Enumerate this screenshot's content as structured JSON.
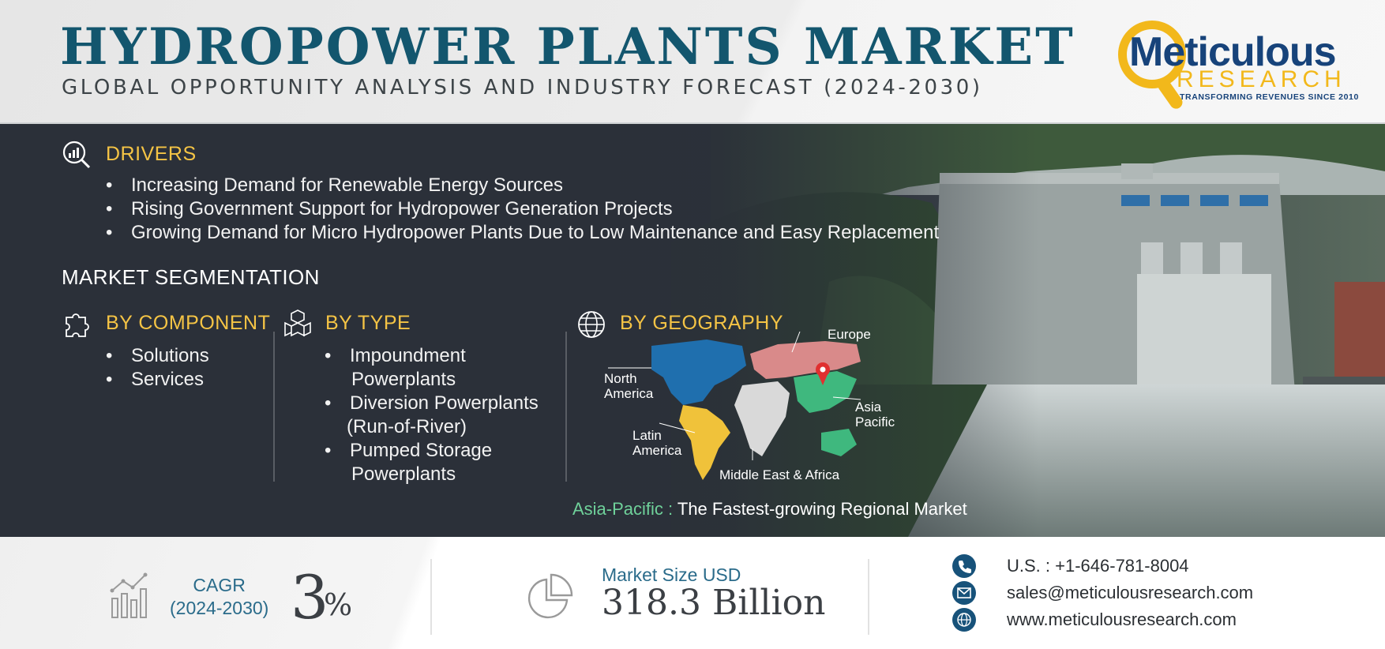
{
  "header": {
    "title": "HYDROPOWER PLANTS MARKET",
    "subtitle": "GLOBAL OPPORTUNITY ANALYSIS AND INDUSTRY FORECAST (2024-2030)"
  },
  "logo": {
    "word": "Meticulous",
    "research": "RESEARCH",
    "tagline": "TRANSFORMING REVENUES SINCE 2010"
  },
  "drivers": {
    "heading": "DRIVERS",
    "icon": "magnifier-chart-icon",
    "items": [
      "Increasing Demand for Renewable Energy Sources",
      "Rising Government Support for Hydropower Generation Projects",
      "Growing Demand for Micro Hydropower Plants Due to Low Maintenance and Easy Replacement"
    ]
  },
  "segmentation": {
    "heading": "MARKET SEGMENTATION",
    "by_component": {
      "heading": "BY COMPONENT",
      "icon": "puzzle-icon",
      "items": [
        "Solutions",
        "Services"
      ]
    },
    "by_type": {
      "heading": "BY TYPE",
      "icon": "cubes-icon",
      "items": [
        {
          "line1": "Impoundment",
          "line2": "Powerplants"
        },
        {
          "line1": "Diversion Powerplants",
          "line2": "(Run-of-River)"
        },
        {
          "line1": "Pumped Storage",
          "line2": "Powerplants"
        }
      ]
    },
    "by_geography": {
      "heading": "BY GEOGRAPHY",
      "icon": "globe-icon",
      "regions": {
        "europe": "Europe",
        "north_america_1": "North",
        "north_america_2": "America",
        "asia_pacific_1": "Asia",
        "asia_pacific_2": "Pacific",
        "latin_america_1": "Latin",
        "latin_america_2": "America",
        "mea": "Middle East & Africa"
      },
      "region_colors": {
        "north_america": "#1f6fae",
        "europe": "#d98a8a",
        "asia_pacific": "#3fb87e",
        "latin_america": "#f0c23a",
        "mea": "#d9d9d9"
      }
    }
  },
  "fastest": {
    "highlight": "Asia-Pacific :",
    "text": "The Fastest-growing Regional Market"
  },
  "footer": {
    "cagr_label_1": "CAGR",
    "cagr_label_2": "(2024-2030)",
    "cagr_value": "3",
    "cagr_unit": "%",
    "market_label": "Market Size USD",
    "market_value": "318.3 Billion",
    "phone": "U.S. : +1-646-781-8004",
    "email": "sales@meticulousresearch.com",
    "website": "www.meticulousresearch.com"
  },
  "colors": {
    "title": "#13566e",
    "accent": "#f5c445",
    "highlight_green": "#6fd19a",
    "contact_icon": "#17527a"
  }
}
